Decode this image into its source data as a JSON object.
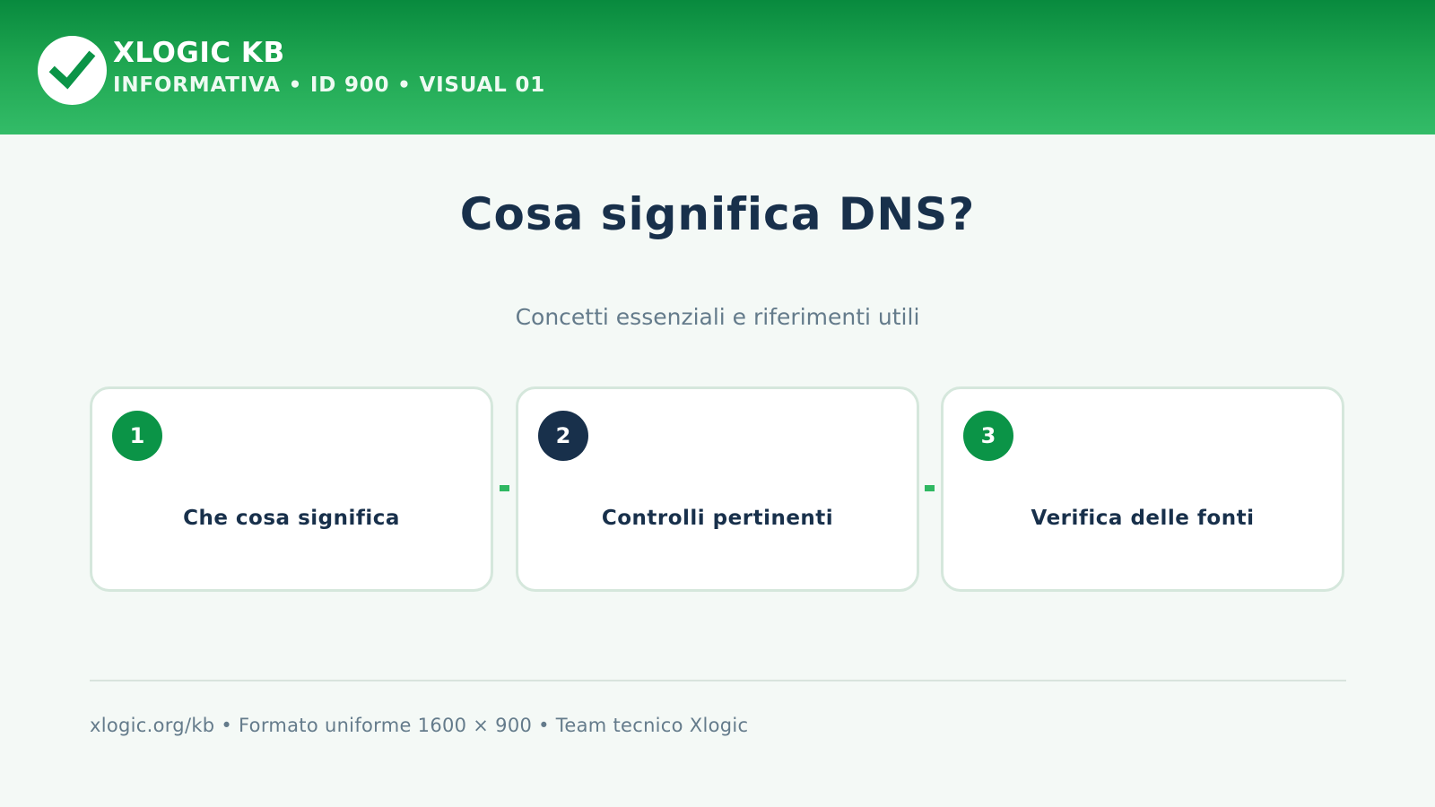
{
  "header": {
    "brand": "XLOGIC KB",
    "subtitle": "INFORMATIVA • ID 900 • VISUAL 01",
    "logo_icon": "check-icon"
  },
  "main": {
    "title": "Cosa significa DNS?",
    "subtitle": "Concetti essenziali e riferimenti utili",
    "steps": [
      {
        "number": "1",
        "label": "Che cosa significa",
        "badge_color": "#0b9447"
      },
      {
        "number": "2",
        "label": "Controlli pertinenti",
        "badge_color": "#18304b"
      },
      {
        "number": "3",
        "label": "Verifica delle fonti",
        "badge_color": "#0b9447"
      }
    ]
  },
  "footer": {
    "text": "xlogic.org/kb • Formato uniforme 1600 × 900 • Team tecnico Xlogic"
  },
  "colors": {
    "accent": "#0b9447",
    "navy": "#18304b",
    "header_top": "#088a3e",
    "header_bottom": "#33bc68",
    "background": "#f4f9f6"
  }
}
